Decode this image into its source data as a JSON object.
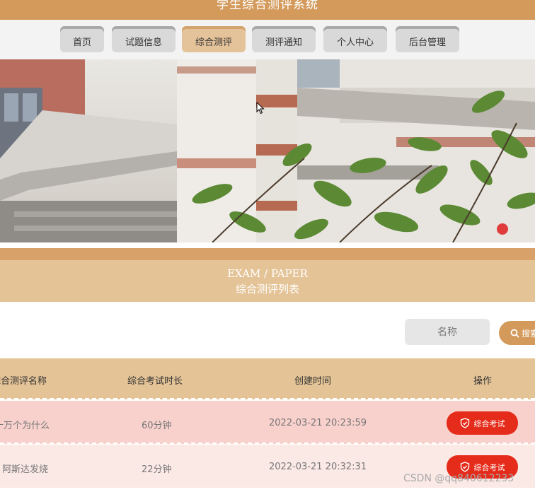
{
  "app": {
    "title": "学生综合测评系统"
  },
  "nav": {
    "items": [
      {
        "label": "首页"
      },
      {
        "label": "试题信息"
      },
      {
        "label": "综合测评",
        "active": true
      },
      {
        "label": "测评通知"
      },
      {
        "label": "个人中心"
      },
      {
        "label": "后台管理"
      }
    ]
  },
  "section": {
    "en_title": "EXAM / PAPER",
    "zh_title": "综合测评列表"
  },
  "search": {
    "placeholder": "名称",
    "button_label": "搜索"
  },
  "table": {
    "headers": [
      "综合测评名称",
      "综合考试时长",
      "创建时间",
      "操作"
    ],
    "rows": [
      {
        "name": "十万个为什么",
        "duration": "60分钟",
        "created": "2022-03-21 20:23:59",
        "action": "综合考试"
      },
      {
        "name": "阿斯达发烧",
        "duration": "22分钟",
        "created": "2022-03-21 20:32:31",
        "action": "综合考试"
      }
    ]
  },
  "watermark": "CSDN @qq840612233",
  "colors": {
    "brand": "#d39a5b",
    "nav_active": "#e5c39a",
    "header_band": "#e4c396",
    "danger_button": "#e52b1a",
    "row_odd": "#f8d1cc",
    "row_even": "#fbe9e6"
  }
}
